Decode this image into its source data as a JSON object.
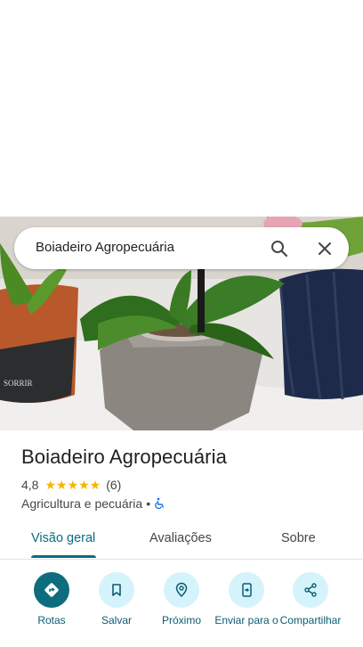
{
  "search": {
    "query": "Boiadeiro Agropecuária"
  },
  "place": {
    "name": "Boiadeiro Agropecuária",
    "rating": "4,8",
    "stars": "★★★★★",
    "reviews_count": "(6)",
    "category": "Agricultura e pecuária",
    "separator": "•"
  },
  "tabs": [
    {
      "label": "Visão geral"
    },
    {
      "label": "Avaliações"
    },
    {
      "label": "Sobre"
    }
  ],
  "actions": [
    {
      "label": "Rotas",
      "icon": "directions-icon"
    },
    {
      "label": "Salvar",
      "icon": "bookmark-icon"
    },
    {
      "label": "Próximo",
      "icon": "nearby-icon"
    },
    {
      "label": "Enviar para o",
      "icon": "send-to-phone-icon"
    },
    {
      "label": "Compartilhar",
      "icon": "share-icon"
    }
  ],
  "colors": {
    "accent": "#0b6b85",
    "primary_action": "#0e6d7d",
    "action_bg": "#d5f3fb",
    "star": "#f6b400"
  }
}
